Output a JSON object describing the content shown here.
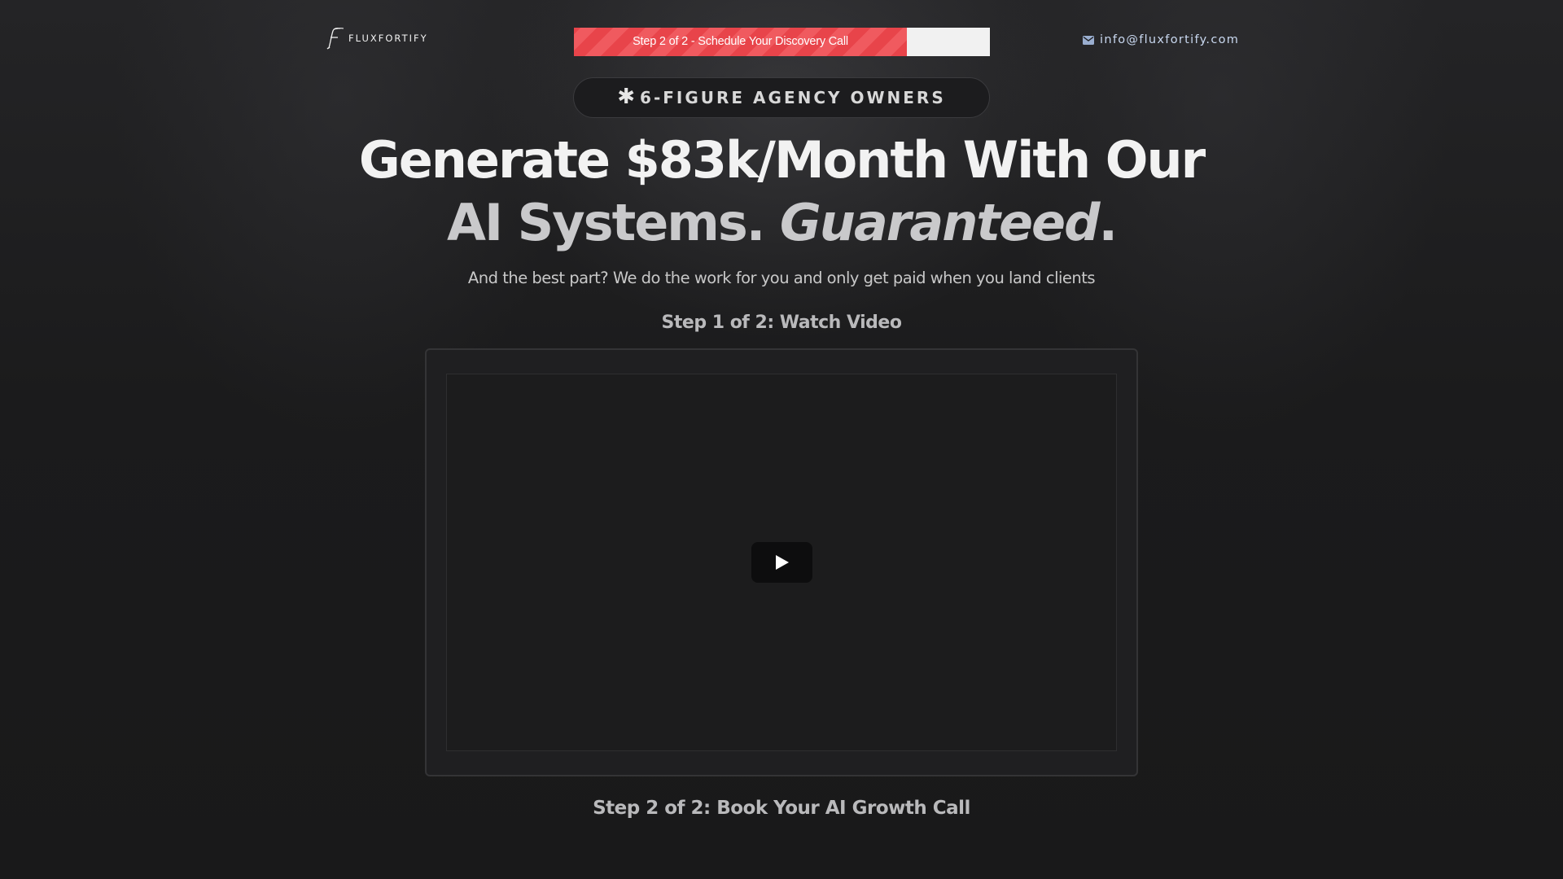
{
  "header": {
    "logo_text": "FLUXFORTIFY",
    "logo_icon": "script-f-logo",
    "progress": {
      "label": "Step 2 of 2 - Schedule Your Discovery Call",
      "percent": 80,
      "fill_color": "#e8444a"
    },
    "contact": {
      "icon": "envelope-icon",
      "email": "info@fluxfortify.com"
    }
  },
  "badge": {
    "icon": "✱",
    "text": "6-FIGURE AGENCY OWNERS"
  },
  "headline": {
    "line1": "Generate $83k/Month With Our",
    "line2_prefix": "AI Systems. ",
    "line2_emphasis": "Guaranteed",
    "line2_suffix": "."
  },
  "subtitle": "And the best part? We do the work for you and only get paid when you land clients",
  "step1": {
    "title": "Step 1 of 2: Watch Video"
  },
  "video": {
    "play_icon": "play-icon"
  },
  "step2": {
    "title": "Step 2 of 2: Book Your AI Growth Call"
  },
  "colors": {
    "background": "#1a1a1b",
    "accent": "#e8444a",
    "contact_text": "#c9d8f0"
  }
}
